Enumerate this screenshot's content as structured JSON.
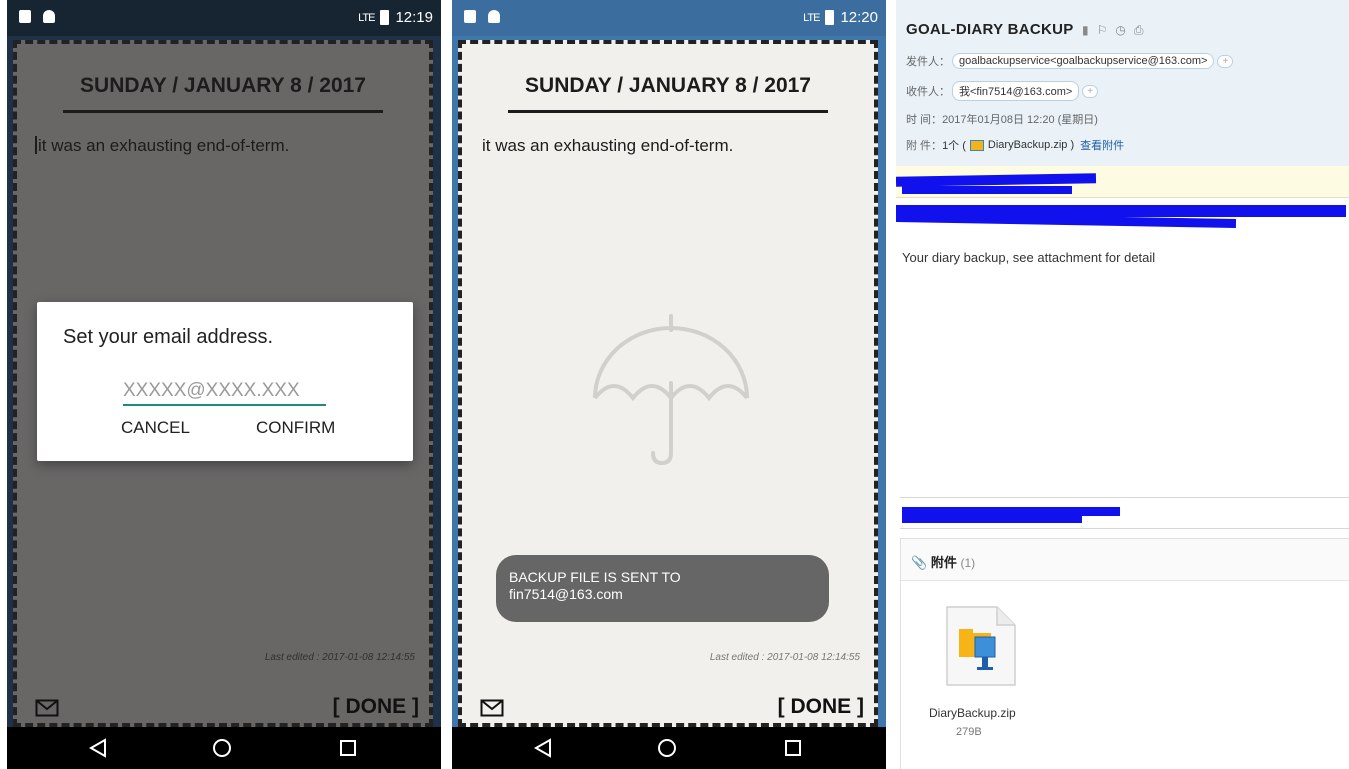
{
  "phone1": {
    "status_time": "12:19",
    "signal": "LTE",
    "date_title": "SUNDAY / JANUARY 8 / 2017",
    "entry_text": "it was an exhausting end-of-term.",
    "last_edited": "Last edited : 2017-01-08 12:14:55",
    "done_label": "[ DONE ]",
    "dialog": {
      "title": "Set your email address.",
      "placeholder": "XXXXX@XXXX.XXX",
      "cancel": "CANCEL",
      "confirm": "CONFIRM"
    }
  },
  "phone2": {
    "status_time": "12:20",
    "signal": "LTE",
    "date_title": "SUNDAY / JANUARY 8 / 2017",
    "entry_text": "it was an exhausting end-of-term.",
    "last_edited": "Last edited : 2017-01-08 12:14:55",
    "done_label": "[ DONE ]",
    "toast_line1": "BACKUP FILE IS SENT TO",
    "toast_line2": "fin7514@163.com"
  },
  "email": {
    "subject": "GOAL-DIARY BACKUP",
    "from_label": "发件人：",
    "from_value": "goalbackupservice<goalbackupservice@163.com>",
    "to_label": "收件人：",
    "to_value": "我<fin7514@163.com>",
    "time_label": "时  间：",
    "time_value": "2017年01月08日 12:20 (星期日)",
    "attach_label": "附  件：",
    "attach_prefix": "1个 (",
    "attach_file": "DiaryBackup.zip )",
    "attach_link": "查看附件",
    "body": "Your diary backup, see attachment for detail",
    "attach_section_title": "附件",
    "attach_section_count": "(1)",
    "file_name": "DiaryBackup.zip",
    "file_size": "279B"
  }
}
